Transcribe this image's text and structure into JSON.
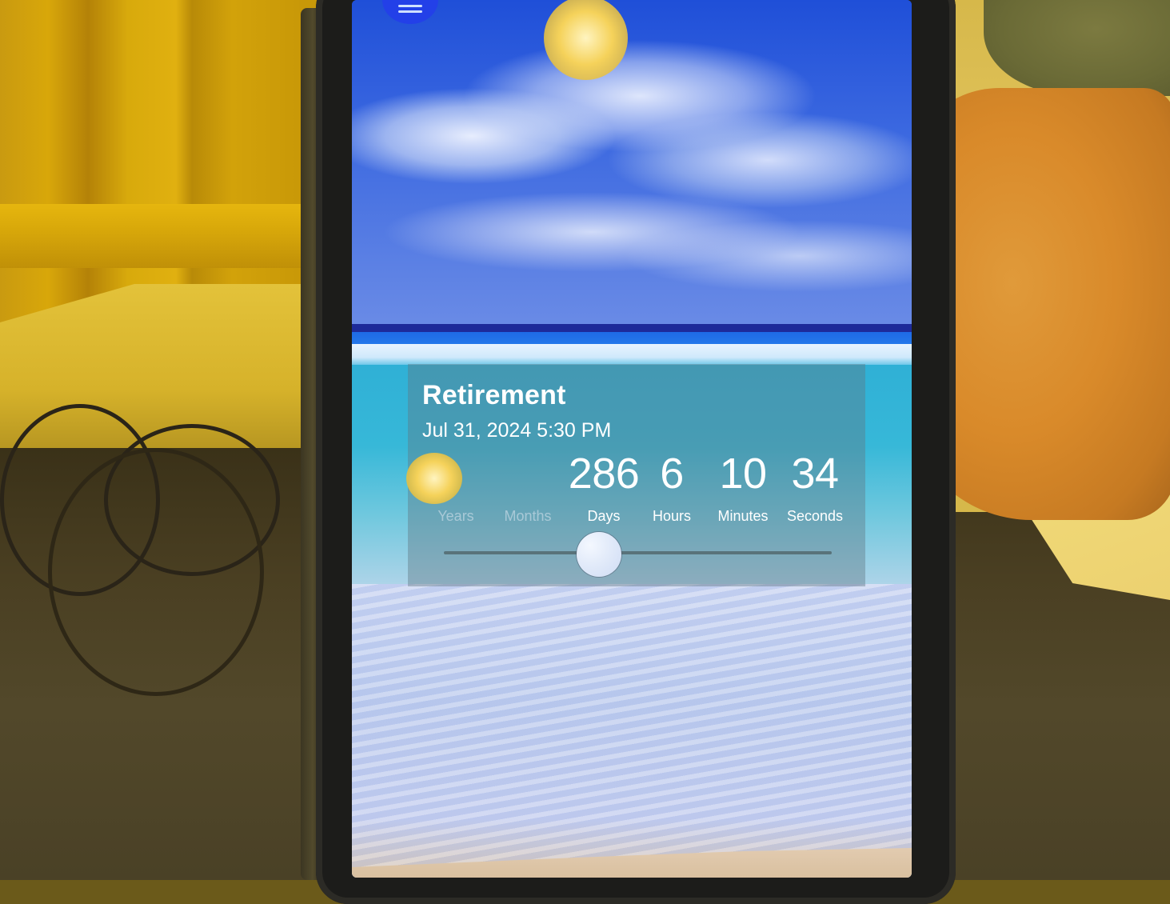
{
  "app": {
    "menu_icon": "hamburger-menu-icon"
  },
  "countdown": {
    "title": "Retirement",
    "target_datetime": "Jul 31, 2024 5:30 PM",
    "units": [
      {
        "key": "years",
        "label": "Years",
        "value": "",
        "dimmed": true
      },
      {
        "key": "months",
        "label": "Months",
        "value": "",
        "dimmed": true
      },
      {
        "key": "days",
        "label": "Days",
        "value": "286",
        "dimmed": false
      },
      {
        "key": "hours",
        "label": "Hours",
        "value": "6",
        "dimmed": false
      },
      {
        "key": "minutes",
        "label": "Minutes",
        "value": "10",
        "dimmed": false
      },
      {
        "key": "seconds",
        "label": "Seconds",
        "value": "34",
        "dimmed": false
      }
    ],
    "unit_slider": {
      "min_unit": "Years",
      "max_unit": "Seconds",
      "selected_position_fraction": 0.4
    }
  },
  "colors": {
    "menu_button": "#2340e8",
    "card_overlay": "#5f7882",
    "text": "#ffffff"
  }
}
